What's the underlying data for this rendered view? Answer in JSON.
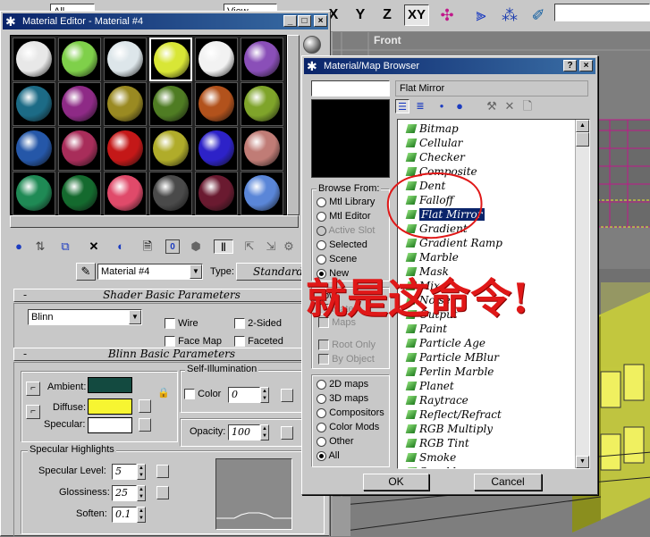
{
  "background": {
    "top_toolbar": {
      "axis_buttons": [
        "X",
        "Y",
        "Z",
        "XY"
      ],
      "left_dropdown": "All",
      "view_dropdown": "View"
    },
    "viewport": {
      "label": "Front"
    }
  },
  "material_editor": {
    "title": "Material Editor - Material #4",
    "slots": [
      {
        "color": "#e8e8e8",
        "selected": false
      },
      {
        "color": "#7fd04a",
        "selected": false
      },
      {
        "color": "#dde6ea",
        "selected": false
      },
      {
        "color": "#d8e636",
        "selected": true
      },
      {
        "color": "#f2f2f2",
        "selected": false
      },
      {
        "color": "#8a4fb8",
        "selected": false
      },
      {
        "color": "#1c6b86",
        "selected": false
      },
      {
        "color": "#8e2a86",
        "selected": false
      },
      {
        "color": "#9a8a22",
        "selected": false
      },
      {
        "color": "#4f7c23",
        "selected": false
      },
      {
        "color": "#b2521c",
        "selected": false
      },
      {
        "color": "#7fa42a",
        "selected": false
      },
      {
        "color": "#2557a8",
        "selected": false
      },
      {
        "color": "#a82d5a",
        "selected": false
      },
      {
        "color": "#c41818",
        "selected": false
      },
      {
        "color": "#b0ac2a",
        "selected": false
      },
      {
        "color": "#2d22c8",
        "selected": false
      },
      {
        "color": "#c07c76",
        "selected": false
      },
      {
        "color": "#1f8a55",
        "selected": false
      },
      {
        "color": "#146a2e",
        "selected": false
      },
      {
        "color": "#e04a6a",
        "selected": false
      },
      {
        "color": "#4a4a4a",
        "selected": false
      },
      {
        "color": "#6a1a30",
        "selected": false
      },
      {
        "color": "#5a86d8",
        "selected": false
      }
    ],
    "material_name": "Material #4",
    "type_label": "Type:",
    "type_value": "Standard",
    "shader_rollout": {
      "title": "Shader Basic Parameters",
      "shader": "Blinn",
      "options": [
        "Wire",
        "2-Sided",
        "Face Map",
        "Faceted"
      ]
    },
    "blinn_rollout": {
      "title": "Blinn Basic Parameters",
      "ambient_label": "Ambient:",
      "diffuse_label": "Diffuse:",
      "specular_label": "Specular:",
      "ambient_color": "#134a40",
      "diffuse_color": "#f7f531",
      "specular_color": "#ffffff",
      "self_illum": {
        "title": "Self-Illumination",
        "color_label": "Color",
        "value": "0"
      },
      "opacity_label": "Opacity:",
      "opacity_value": "100"
    },
    "specular_highlights": {
      "title": "Specular Highlights",
      "level_label": "Specular Level:",
      "level_value": "5",
      "gloss_label": "Glossiness:",
      "gloss_value": "25",
      "soften_label": "Soften:",
      "soften_value": "0.1"
    }
  },
  "browser": {
    "title": "Material/Map Browser",
    "search_value": "",
    "selected_name": "Flat Mirror",
    "browse_from": {
      "title": "Browse From:",
      "options": [
        {
          "label": "Mtl Library",
          "checked": false,
          "disabled": false
        },
        {
          "label": "Mtl Editor",
          "checked": false,
          "disabled": false
        },
        {
          "label": "Active Slot",
          "checked": false,
          "disabled": true
        },
        {
          "label": "Selected",
          "checked": false,
          "disabled": false
        },
        {
          "label": "Scene",
          "checked": false,
          "disabled": false
        },
        {
          "label": "New",
          "checked": true,
          "disabled": false
        }
      ]
    },
    "show": {
      "partial_labels": [
        "ow",
        "Mate",
        "Maps"
      ],
      "root_only": "Root Only",
      "by_object": "By Object"
    },
    "categories": [
      {
        "label": "2D maps",
        "checked": false
      },
      {
        "label": "3D maps",
        "checked": false
      },
      {
        "label": "Compositors",
        "checked": false
      },
      {
        "label": "Color Mods",
        "checked": false
      },
      {
        "label": "Other",
        "checked": false
      },
      {
        "label": "All",
        "checked": true
      }
    ],
    "maps": [
      "Bitmap",
      "Cellular",
      "Checker",
      "Composite",
      "Dent",
      "Falloff",
      "Flat Mirror",
      "Gradient",
      "Gradient Ramp",
      "Marble",
      "Mask",
      "Mix",
      "Noise",
      "Output",
      "Paint",
      "Particle Age",
      "Particle MBlur",
      "Perlin Marble",
      "Planet",
      "Raytrace",
      "Reflect/Refract",
      "RGB Multiply",
      "RGB Tint",
      "Smoke",
      "Speckle"
    ],
    "ok_label": "OK",
    "cancel_label": "Cancel"
  },
  "annotation": {
    "text": "就是这命令!",
    "color": "#e01818"
  }
}
